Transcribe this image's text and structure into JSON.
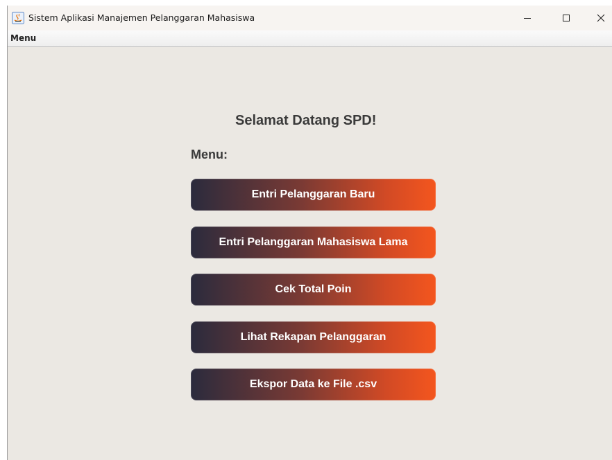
{
  "window": {
    "title": "Sistem Aplikasi Manajemen Pelanggaran Mahasiswa"
  },
  "menubar": {
    "items": [
      {
        "label": "Menu"
      }
    ]
  },
  "main": {
    "heading": "Selamat Datang SPD!",
    "menu_label": "Menu:",
    "buttons": [
      {
        "label": "Entri Pelanggaran Baru"
      },
      {
        "label": "Entri Pelanggaran Mahasiswa Lama"
      },
      {
        "label": "Cek Total Poin"
      },
      {
        "label": "Lihat Rekapan Pelanggaran"
      },
      {
        "label": "Ekspor Data ke File .csv"
      }
    ]
  },
  "colors": {
    "background": "#ebe8e3",
    "button_gradient_start": "#2b2b3d",
    "button_gradient_end": "#f4561e",
    "heading_text": "#3a3a3a"
  }
}
